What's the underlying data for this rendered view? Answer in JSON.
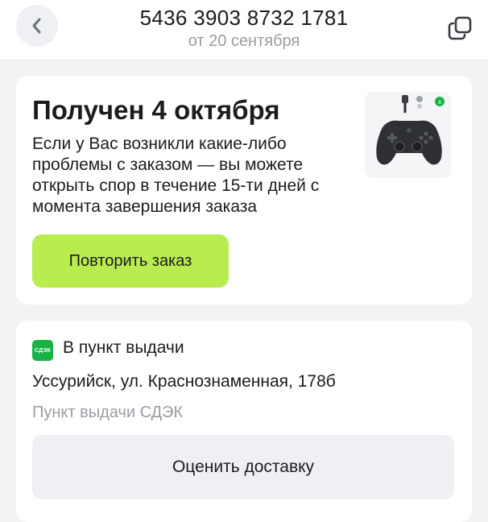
{
  "header": {
    "back_icon": "chevron-left-icon",
    "order_number": "5436 3903 8732 1781",
    "order_date": "от 20 сентября",
    "copy_icon": "copy-icon"
  },
  "status_card": {
    "title": "Получен 4 октября",
    "description": "Если у Вас возникли какие-либо проблемы с заказом — вы можете открыть спор в течение 15-ти дней с момента завершения заказа",
    "product_image": "gamepad-controller-image",
    "repeat_button_label": "Повторить заказ",
    "accent_color": "#b8ec4f"
  },
  "delivery_card": {
    "carrier_logo_text": "СДЭК",
    "carrier_color": "#1ab248",
    "type": "В пункт выдачи",
    "address": "Уссурийск, ул. Краснознаменная, 178б",
    "pickup_point": "Пункт выдачи СДЭК",
    "rate_button_label": "Оценить доставку"
  }
}
